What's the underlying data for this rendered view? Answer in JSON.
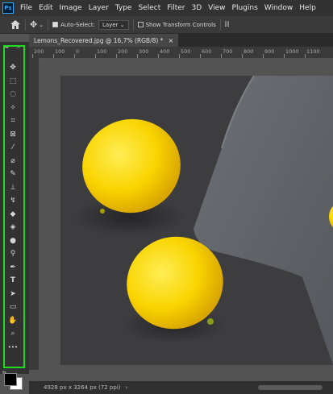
{
  "app": {
    "logo": "Ps"
  },
  "menu": [
    "File",
    "Edit",
    "Image",
    "Layer",
    "Type",
    "Select",
    "Filter",
    "3D",
    "View",
    "Plugins",
    "Window",
    "Help"
  ],
  "options": {
    "auto_select_label": "Auto-Select:",
    "auto_select_checked": true,
    "layer_dropdown": "Layer",
    "transform_label": "Show Transform Controls",
    "transform_checked": false
  },
  "document": {
    "tab_title": "Lemons_Recovered.jpg @ 16,7% (RGB/8) *",
    "close_glyph": "×"
  },
  "ruler": {
    "top_ticks": [
      "200",
      "100",
      "0",
      "100",
      "200",
      "300",
      "400",
      "500",
      "600",
      "700",
      "800",
      "900",
      "1000",
      "1100"
    ]
  },
  "tools": [
    {
      "name": "move-tool",
      "icon": "✥"
    },
    {
      "name": "marquee-tool",
      "icon": "⬚"
    },
    {
      "name": "lasso-tool",
      "icon": "◌"
    },
    {
      "name": "magic-wand-tool",
      "icon": "✧"
    },
    {
      "name": "crop-tool",
      "icon": "⌗"
    },
    {
      "name": "frame-tool",
      "icon": "⊠"
    },
    {
      "name": "eyedropper-tool",
      "icon": "⁄"
    },
    {
      "name": "spot-healing-tool",
      "icon": "⌀"
    },
    {
      "name": "brush-tool",
      "icon": "✎"
    },
    {
      "name": "clone-stamp-tool",
      "icon": "⊥"
    },
    {
      "name": "history-brush-tool",
      "icon": "↯"
    },
    {
      "name": "eraser-tool",
      "icon": "◆"
    },
    {
      "name": "paint-bucket-tool",
      "icon": "◈"
    },
    {
      "name": "blur-tool",
      "icon": "●"
    },
    {
      "name": "dodge-tool",
      "icon": "⚲"
    },
    {
      "name": "pen-tool",
      "icon": "✒"
    },
    {
      "name": "type-tool",
      "icon": "T"
    },
    {
      "name": "path-selection-tool",
      "icon": "➤"
    },
    {
      "name": "rectangle-tool",
      "icon": "▭"
    },
    {
      "name": "hand-tool",
      "icon": "✋"
    },
    {
      "name": "zoom-tool",
      "icon": "⌕"
    },
    {
      "name": "more-tools",
      "icon": "•••"
    }
  ],
  "colors": {
    "foreground": "#000000",
    "background": "#ffffff",
    "highlight": "#1fdb1f"
  },
  "status": {
    "doc_size": "4928 px x 3264 px (72 ppi)"
  }
}
